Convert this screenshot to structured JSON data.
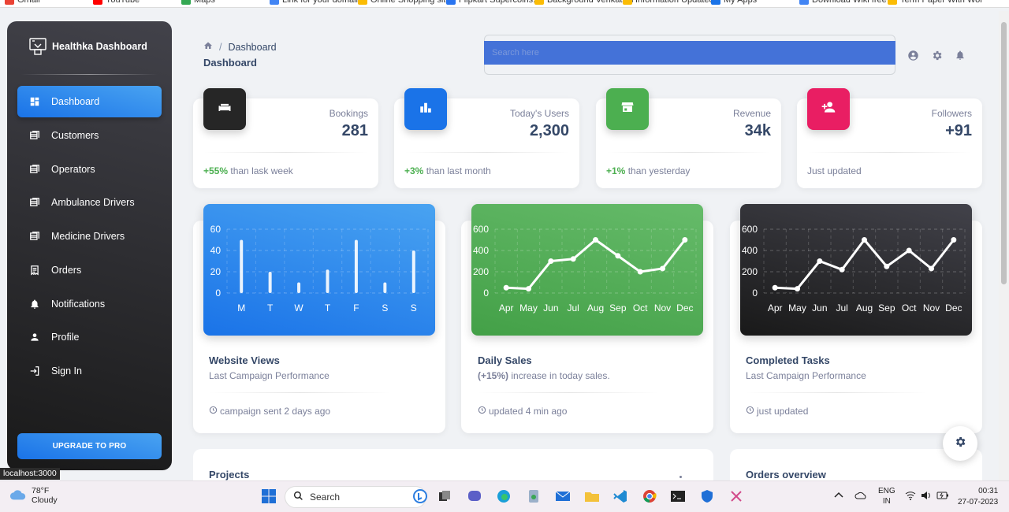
{
  "bookmarks": [
    "Gmail",
    "YouTube",
    "Maps",
    "Link for your domain",
    "Online Shopping site",
    "Flipkart Supercoins...",
    "Background Venkatsai",
    "Information Updated",
    "My Apps",
    "Download Wiki free",
    "Term Paper With Wor"
  ],
  "sidebar": {
    "brand": "Healthka Dashboard",
    "items": [
      {
        "label": "Dashboard",
        "icon": "dashboard-icon"
      },
      {
        "label": "Customers",
        "icon": "table-icon"
      },
      {
        "label": "Operators",
        "icon": "table-icon"
      },
      {
        "label": "Ambulance Drivers",
        "icon": "table-icon"
      },
      {
        "label": "Medicine Drivers",
        "icon": "table-icon"
      },
      {
        "label": "Orders",
        "icon": "receipt-icon"
      },
      {
        "label": "Notifications",
        "icon": "bell-icon"
      },
      {
        "label": "Profile",
        "icon": "person-icon"
      },
      {
        "label": "Sign In",
        "icon": "login-icon"
      }
    ],
    "upgrade": "UPGRADE TO PRO"
  },
  "status_url": "localhost:3000",
  "header": {
    "breadcrumb_current": "Dashboard",
    "title": "Dashboard",
    "search_placeholder": "Search here"
  },
  "stats": [
    {
      "label": "Bookings",
      "value": "281",
      "delta": "+55%",
      "note": "than lask week",
      "color": "#262626",
      "icon": "weekend-icon"
    },
    {
      "label": "Today's Users",
      "value": "2,300",
      "delta": "+3%",
      "note": "than last month",
      "color": "#1A73E8",
      "icon": "leaderboard-icon"
    },
    {
      "label": "Revenue",
      "value": "34k",
      "delta": "+1%",
      "note": "than yesterday",
      "color": "#4CAF50",
      "icon": "store-icon"
    },
    {
      "label": "Followers",
      "value": "+91",
      "delta": "",
      "note": "Just updated",
      "color": "#E91E63",
      "icon": "person-add-icon"
    }
  ],
  "cards": [
    {
      "title": "Website Views",
      "subtitle": "Last Campaign Performance",
      "footer": "campaign sent 2 days ago"
    },
    {
      "title": "Daily Sales",
      "subtitle_bold": "(+15%)",
      "subtitle": " increase in today sales.",
      "footer": "updated 4 min ago"
    },
    {
      "title": "Completed Tasks",
      "subtitle": "Last Campaign Performance",
      "footer": "just updated"
    }
  ],
  "bottom": {
    "projects": "Projects",
    "orders": "Orders overview"
  },
  "chart_data": [
    {
      "type": "bar",
      "categories": [
        "M",
        "T",
        "W",
        "T",
        "F",
        "S",
        "S"
      ],
      "values": [
        50,
        20,
        10,
        22,
        50,
        10,
        40
      ],
      "y_ticks": [
        0,
        20,
        40,
        60
      ],
      "ylim": [
        0,
        60
      ],
      "grid": true
    },
    {
      "type": "line",
      "categories": [
        "Apr",
        "May",
        "Jun",
        "Jul",
        "Aug",
        "Sep",
        "Oct",
        "Nov",
        "Dec"
      ],
      "values": [
        50,
        40,
        300,
        320,
        500,
        350,
        200,
        230,
        500
      ],
      "y_ticks": [
        0,
        200,
        400,
        600
      ],
      "ylim": [
        0,
        600
      ],
      "grid": true
    },
    {
      "type": "line",
      "categories": [
        "Apr",
        "May",
        "Jun",
        "Jul",
        "Aug",
        "Sep",
        "Oct",
        "Nov",
        "Dec"
      ],
      "values": [
        50,
        40,
        300,
        220,
        500,
        250,
        400,
        230,
        500
      ],
      "y_ticks": [
        0,
        200,
        400,
        600
      ],
      "ylim": [
        0,
        600
      ],
      "grid": true
    }
  ],
  "taskbar": {
    "temp": "78°F",
    "condition": "Cloudy",
    "search": "Search",
    "lang_top": "ENG",
    "lang_bottom": "IN",
    "time": "00:31",
    "date": "27-07-2023"
  }
}
